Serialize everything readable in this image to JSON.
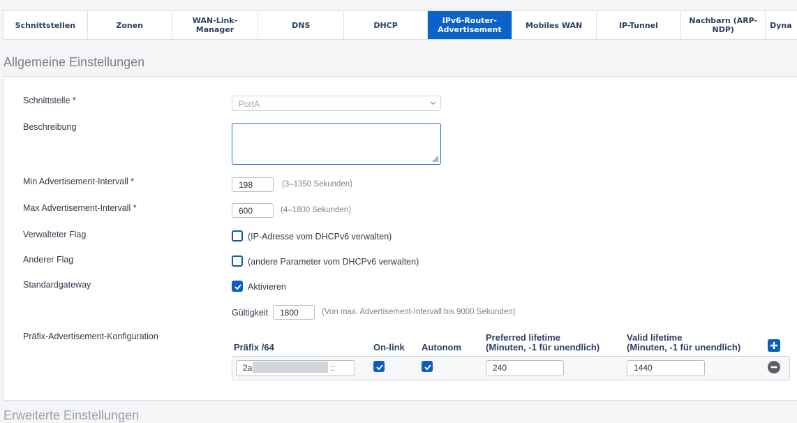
{
  "tabs": [
    {
      "label": "Schnittstellen",
      "active": false
    },
    {
      "label": "Zonen",
      "active": false
    },
    {
      "label": "WAN-Link-Manager",
      "active": false
    },
    {
      "label": "DNS",
      "active": false
    },
    {
      "label": "DHCP",
      "active": false
    },
    {
      "label": "IPv6-Router-Advertisement",
      "active": true
    },
    {
      "label": "Mobiles WAN",
      "active": false
    },
    {
      "label": "IP-Tunnel",
      "active": false
    },
    {
      "label": "Nachbarn (ARP-NDP)",
      "active": false
    },
    {
      "label": "Dyna",
      "active": false
    }
  ],
  "section_title": "Allgemeine Einstellungen",
  "form": {
    "interface": {
      "label": "Schnittstelle *",
      "value": "PortA"
    },
    "description": {
      "label": "Beschreibung",
      "value": ""
    },
    "min_interval": {
      "label": "Min Advertisement-Intervall *",
      "value": "198",
      "hint": "(3–1350 Sekunden)"
    },
    "max_interval": {
      "label": "Max Advertisement-Intervall *",
      "value": "600",
      "hint": "(4–1800 Sekunden)"
    },
    "managed_flag": {
      "label": "Verwalteter Flag",
      "checked": false,
      "text": "(IP-Adresse vom DHCPv6 verwalten)"
    },
    "other_flag": {
      "label": "Anderer Flag",
      "checked": false,
      "text": "(andere Parameter vom DHCPv6 verwalten)"
    },
    "default_gateway": {
      "label": "Standardgateway",
      "checked": true,
      "text": "Aktivieren"
    },
    "validity": {
      "label": "Gültigkeit",
      "value": "1800",
      "hint": "(Von max. Advertisement-Intervall bis 9000 Sekunden)"
    },
    "prefix_config": {
      "label": "Präfix-Advertisement-Konfiguration"
    }
  },
  "prefix_table": {
    "headers": {
      "prefix": "Präfix /64",
      "onlink": "On-link",
      "autonom": "Autonom",
      "preferred_line1": "Preferred lifetime",
      "preferred_line2": "(Minuten, -1 für unendlich)",
      "valid_line1": "Valid lifetime",
      "valid_line2": "(Minuten, -1 für unendlich)"
    },
    "rows": [
      {
        "prefix_start": "2a",
        "prefix_end": "::",
        "onlink": true,
        "autonom": true,
        "preferred": "240",
        "valid": "1440"
      }
    ]
  },
  "next_section_title": "Erweiterte Einstellungen"
}
